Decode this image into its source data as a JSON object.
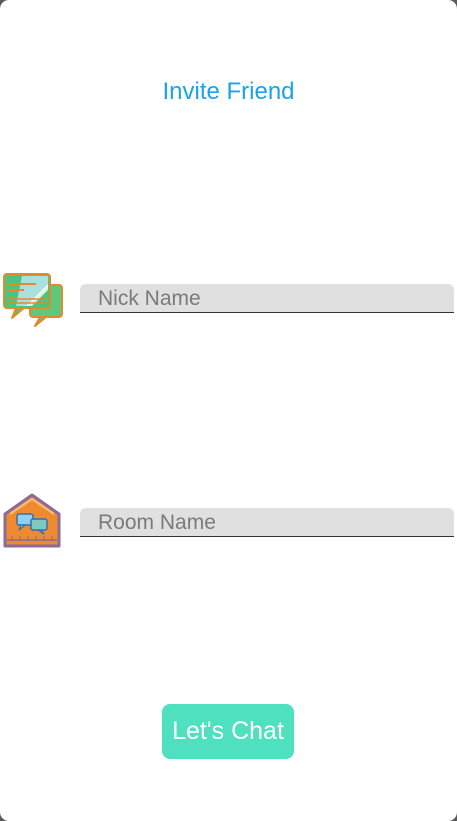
{
  "header": {
    "invite_label": "Invite Friend"
  },
  "form": {
    "nick_placeholder": "Nick Name",
    "nick_value": "",
    "room_placeholder": "Room Name",
    "room_value": ""
  },
  "actions": {
    "submit_label": "Let's Chat"
  },
  "icons": {
    "nick": "chat-bubbles-icon",
    "room": "chat-room-house-icon"
  },
  "colors": {
    "accent_link": "#1aa3e8",
    "button": "#4fe0bf",
    "field_bg": "#e0e0e0"
  }
}
